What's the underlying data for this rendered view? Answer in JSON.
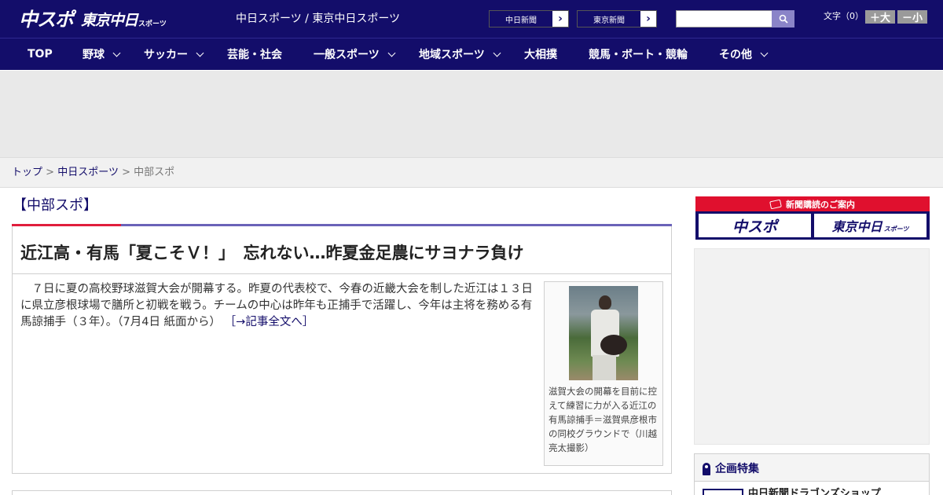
{
  "header": {
    "logo_main": "中スポ",
    "logo_tokyo": "東京中日",
    "logo_tokyo_sub": "スポーツ",
    "tagline": "中日スポーツ / 東京中日スポーツ",
    "paper_links": [
      {
        "label": "中日新聞"
      },
      {
        "label": "東京新聞"
      }
    ],
    "search": {
      "placeholder": "",
      "icon": "search-icon"
    },
    "font_size_label": "文字（0）",
    "font_larger": "＋大",
    "font_smaller": "－小",
    "colors": {
      "brand": "#130d6a",
      "accent": "#e01e3c"
    }
  },
  "nav": {
    "items": [
      {
        "label": "TOP",
        "dropdown": false
      },
      {
        "label": "野球",
        "dropdown": true
      },
      {
        "label": "サッカー",
        "dropdown": true
      },
      {
        "label": "芸能・社会",
        "dropdown": false
      },
      {
        "label": "一般スポーツ",
        "dropdown": true
      },
      {
        "label": "地域スポーツ",
        "dropdown": true
      },
      {
        "label": "大相撲",
        "dropdown": false
      },
      {
        "label": "競馬・ボート・競輪",
        "dropdown": false
      },
      {
        "label": "その他",
        "dropdown": true
      }
    ]
  },
  "breadcrumb": {
    "items": [
      "トップ",
      "中日スポーツ",
      "中部スポ"
    ],
    "separator": ">"
  },
  "main": {
    "section_title": "【中部スポ】",
    "article": {
      "headline": "近江高・有馬「夏こそＶ！」　忘れない…昨夏金足農にサヨナラ負け",
      "body": "　７日に夏の高校野球滋賀大会が開幕する。昨夏の代表校で、今春の近畿大会を制した近江は１３日に県立彦根球場で膳所と初戦を戦う。チームの中心は昨年も正捕手で活躍し、今年は主将を務める有馬諒捕手（３年）。（7月4日 紙面から）",
      "more_link": "［→記事全文へ］",
      "photo_caption": "滋賀大会の開幕を目前に控えて練習に力が入る近江の有馬諒捕手＝滋賀県彦根市の同校グラウンドで（川越亮太撮影）"
    }
  },
  "sidebar": {
    "subscription_banner": "新聞購読のご案内",
    "sub_logos": [
      "中スポ",
      "東京中日"
    ],
    "sub_logo_tokyo_sub": "スポーツ",
    "feature_title": "企画特集",
    "feature_item": "中日新聞ドラゴンズショップ"
  }
}
